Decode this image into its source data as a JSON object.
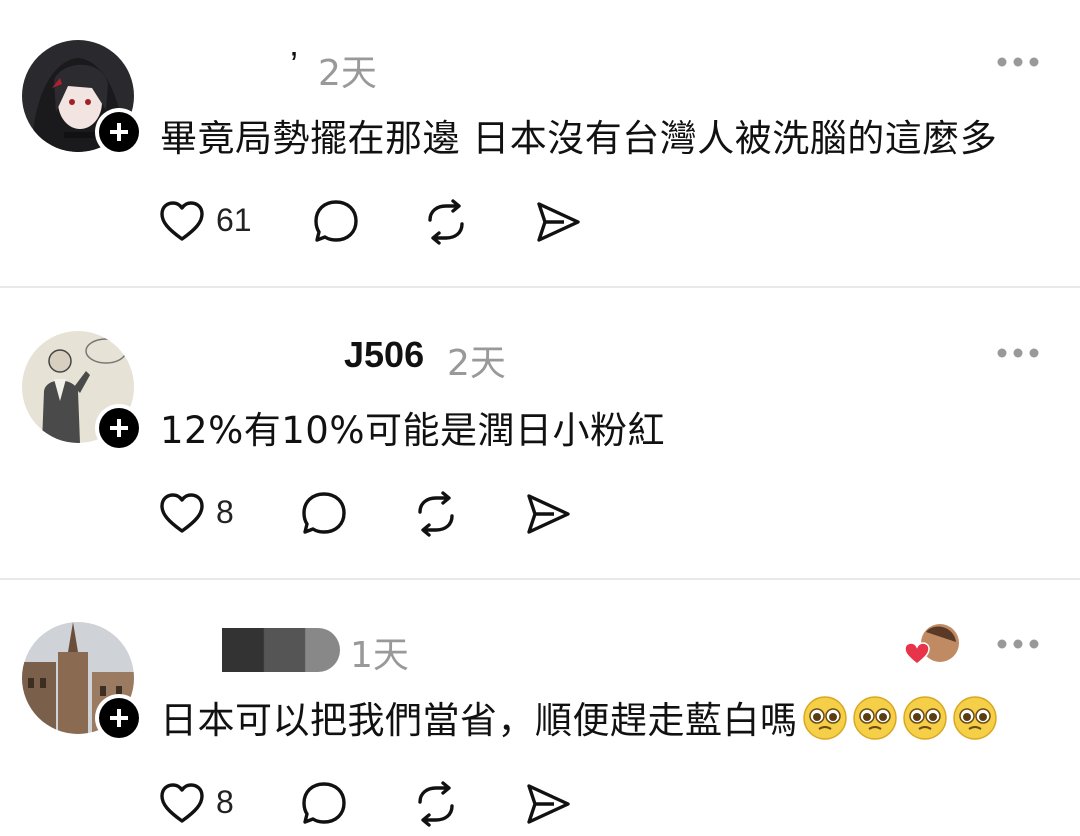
{
  "posts": [
    {
      "username": "",
      "username_tail": "’",
      "time": "2天",
      "content": "畢竟局勢擺在那邊 日本沒有台灣人被洗腦的這麼多",
      "likes": "61",
      "avatar": "anime-girl-avatar"
    },
    {
      "username": "J506",
      "time": "2天",
      "content": "12%有10%可能是潤日小粉紅",
      "likes": "8",
      "avatar": "sketch-man-avatar"
    },
    {
      "username": "",
      "time": "1天",
      "content": "日本可以把我們當省，順便趕走藍白嗎",
      "content_emoji": "🥹🥹🥹🥹",
      "likes": "8",
      "avatar": "cathedral-avatar"
    }
  ],
  "colors": {
    "text": "#111111",
    "muted": "#999999",
    "divider": "#e9e9e9",
    "heart_badge": "#e8344a"
  },
  "icons": [
    "heart-icon",
    "comment-icon",
    "repost-icon",
    "share-icon",
    "more-icon",
    "follow-plus-icon"
  ]
}
